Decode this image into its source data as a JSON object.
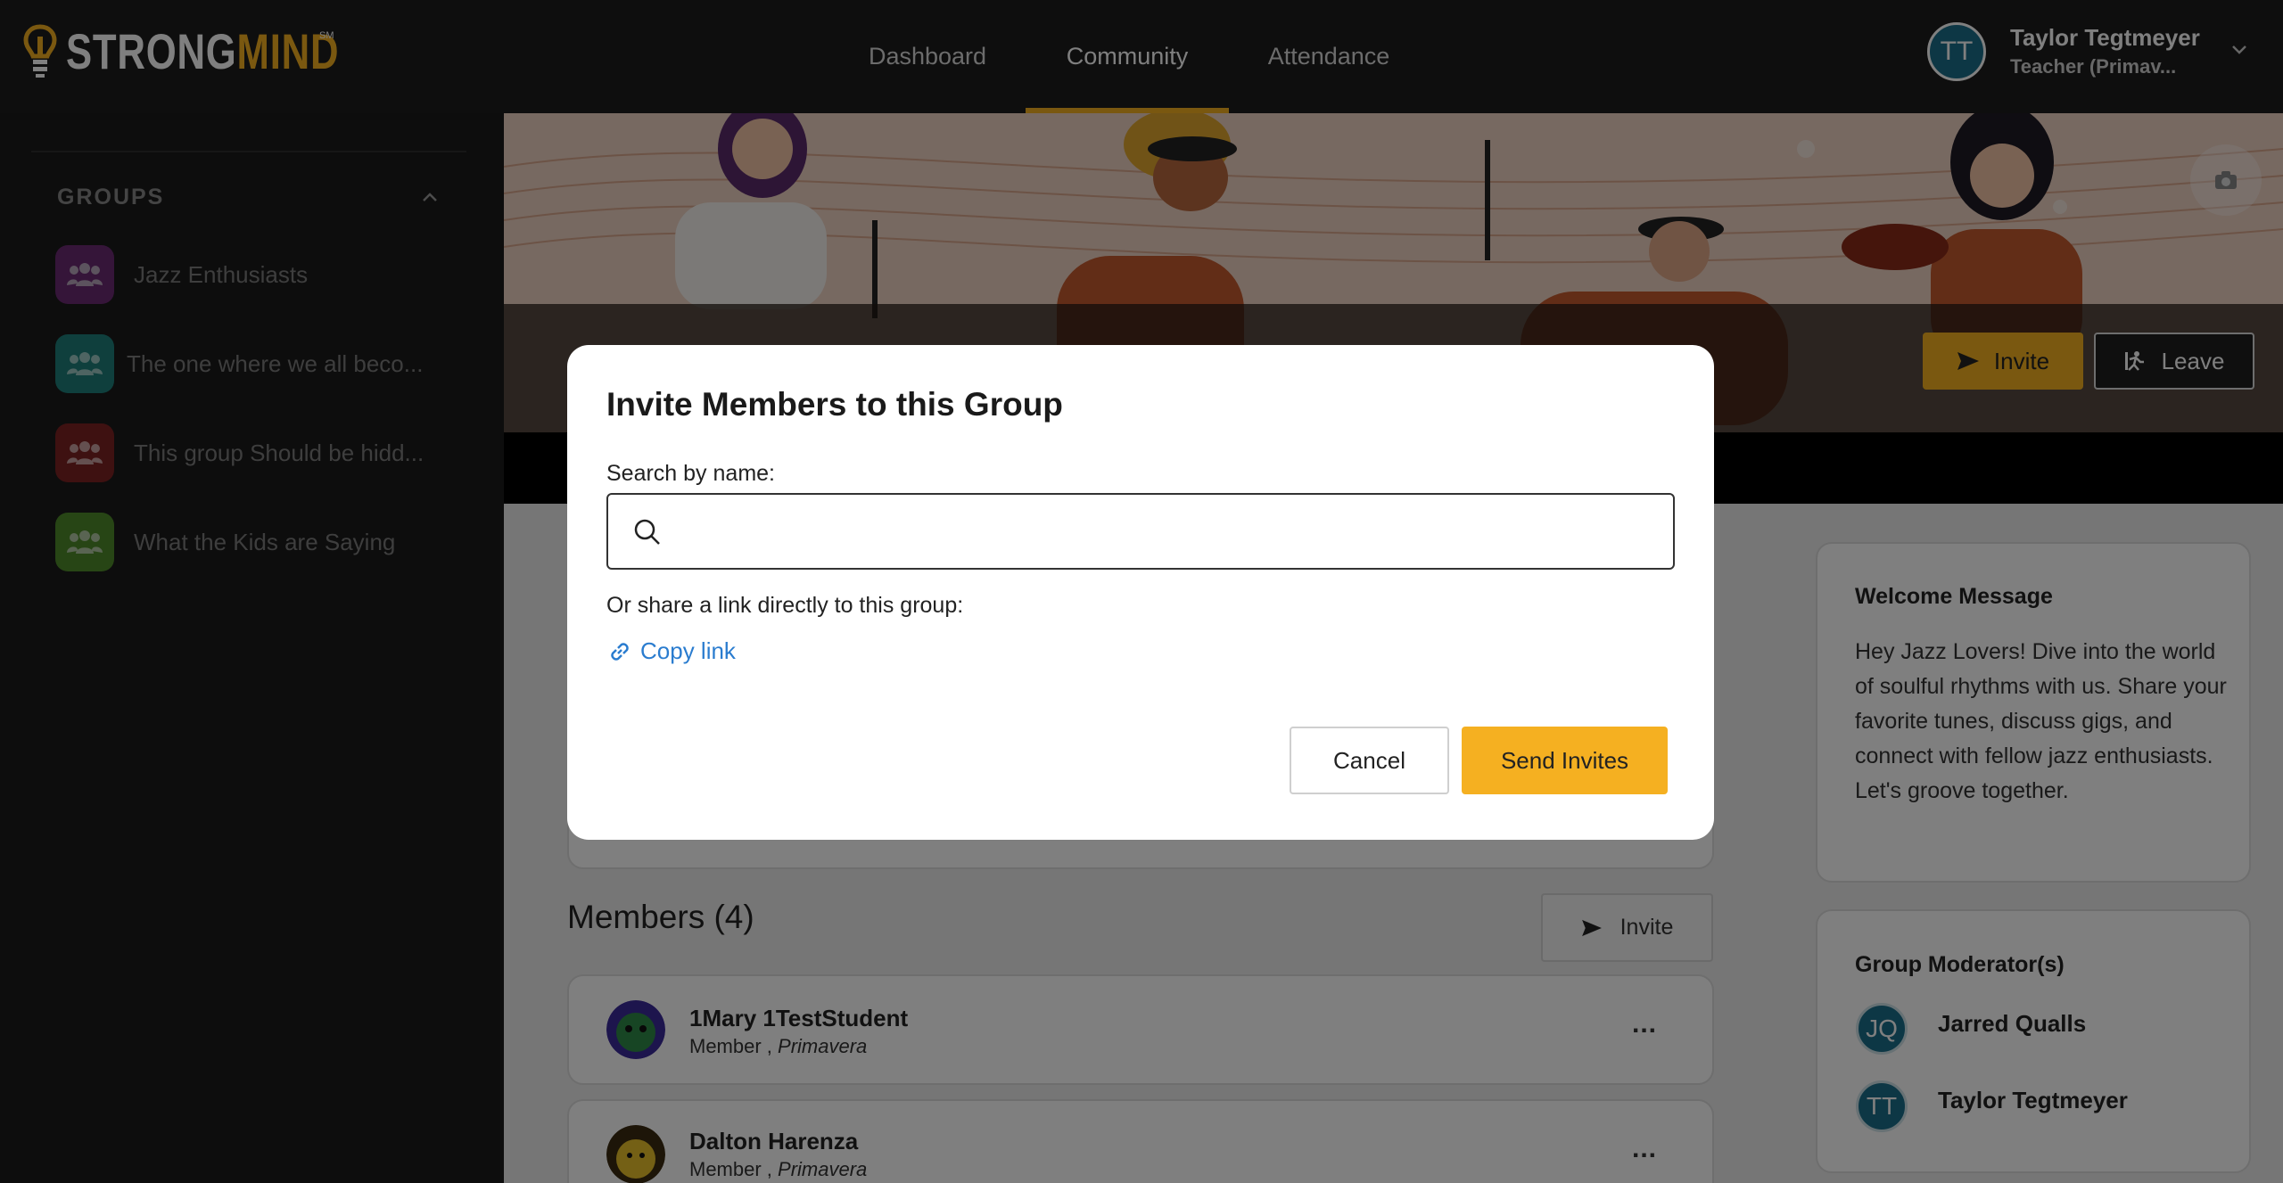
{
  "brand": {
    "strong": "STRONG",
    "mind": "MIND",
    "mark": "SM"
  },
  "nav": {
    "dashboard": "Dashboard",
    "community": "Community",
    "attendance": "Attendance"
  },
  "user": {
    "initials": "TT",
    "name": "Taylor Tegtmeyer",
    "role": "Teacher (Primav..."
  },
  "sidebar": {
    "title": "GROUPS",
    "groups": [
      {
        "label": "Jazz Enthusiasts",
        "color": "#6a2a72"
      },
      {
        "label": "The one where we all beco...",
        "color": "#1e7f7a"
      },
      {
        "label": "This group Should be hidd...",
        "color": "#7d2222"
      },
      {
        "label": "What the Kids are Saying",
        "color": "#4f8a2b"
      }
    ]
  },
  "header": {
    "invite": "Invite",
    "leave": "Leave"
  },
  "members": {
    "title": "Members (4)",
    "invite": "Invite",
    "list": [
      {
        "name": "1Mary 1TestStudent",
        "role": "Member ,",
        "school": "Primavera",
        "more": "..."
      },
      {
        "name": "Dalton Harenza",
        "role": "Member ,",
        "school": "Primavera",
        "more": "..."
      }
    ]
  },
  "welcome": {
    "title": "Welcome Message",
    "text": "Hey Jazz Lovers! Dive into the world of soulful rhythms with us. Share your favorite tunes, discuss gigs, and connect with fellow jazz enthusiasts. Let's groove together."
  },
  "moderators": {
    "title": "Group Moderator(s)",
    "list": [
      {
        "initials": "JQ",
        "name": "Jarred Qualls"
      },
      {
        "initials": "TT",
        "name": "Taylor Tegtmeyer"
      }
    ]
  },
  "modal": {
    "title": "Invite Members to this Group",
    "search_label": "Search by name:",
    "search_value": "",
    "share_label": "Or share a link directly to this group:",
    "copy_link": "Copy link",
    "cancel": "Cancel",
    "send": "Send Invites"
  },
  "colors": {
    "accent": "#f5b021",
    "link": "#2a7ccf",
    "avatar": "#1b6f8a"
  }
}
